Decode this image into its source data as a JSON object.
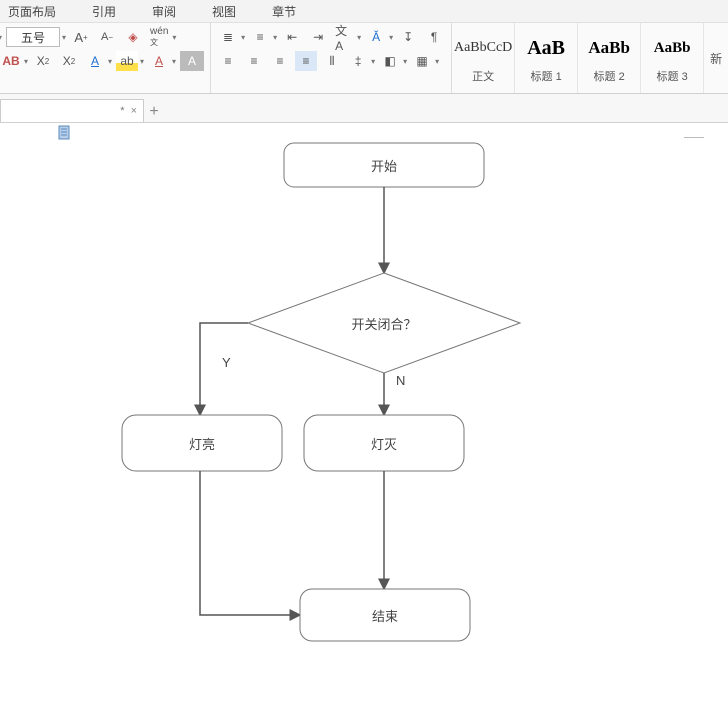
{
  "menu": {
    "layout": "页面布局",
    "refs": "引用",
    "review": "审阅",
    "view": "视图",
    "chapter": "章节"
  },
  "ribbon": {
    "font_size": "五号",
    "tail": "新",
    "styles": [
      {
        "preview": "AaBbCcD",
        "cls": "body",
        "label": "正文"
      },
      {
        "preview": "AaB",
        "cls": "h1",
        "label": "标题 1"
      },
      {
        "preview": "AaBb",
        "cls": "h2",
        "label": "标题 2"
      },
      {
        "preview": "AaBb",
        "cls": "h3",
        "label": "标题 3"
      }
    ]
  },
  "tab": {
    "star": "*",
    "close": "×"
  },
  "flow": {
    "start": "开始",
    "decision": "开关闭合？",
    "yes": "Y",
    "no": "N",
    "lampOn": "灯亮",
    "lampOff": "灯灭",
    "end": "结束"
  }
}
